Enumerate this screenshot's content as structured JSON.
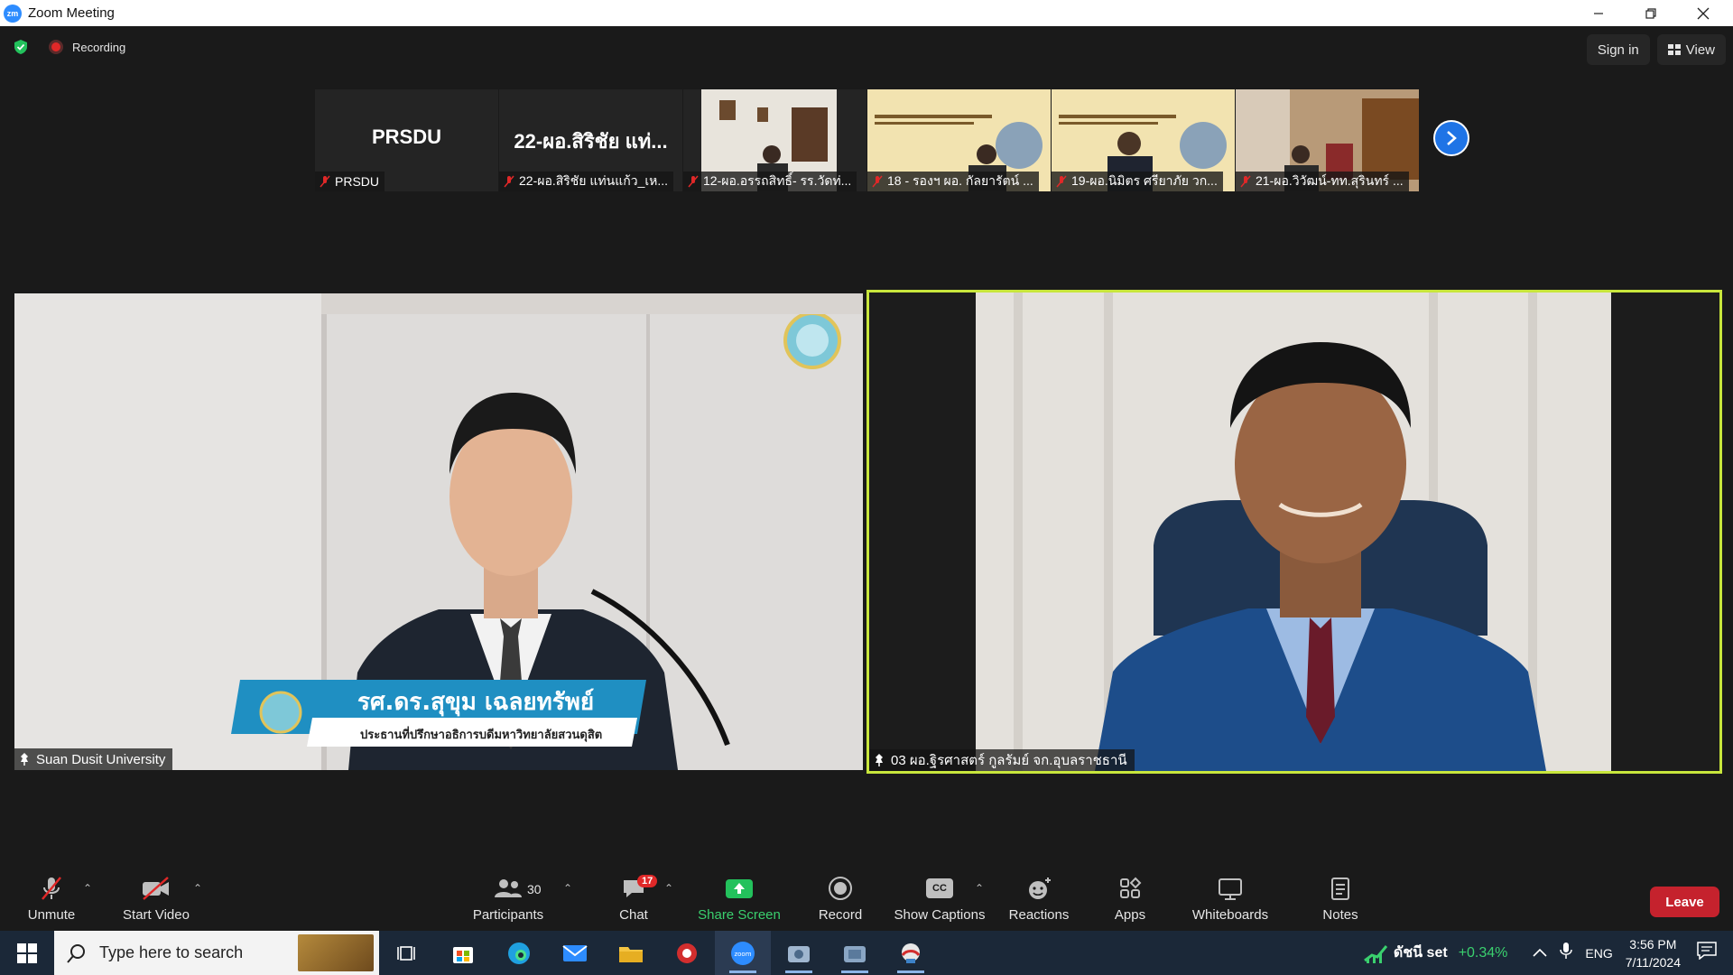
{
  "window": {
    "app_icon_text": "zm",
    "title": "Zoom Meeting"
  },
  "topbar": {
    "recording_label": "Recording",
    "signin_label": "Sign in",
    "view_label": "View"
  },
  "strip": [
    {
      "big_name": "PRSDU",
      "label": "PRSDU",
      "has_video": false
    },
    {
      "big_name": "22-ผอ.สิริชัย แท่...",
      "label": "22-ผอ.สิริชัย แท่นแก้ว_เห...",
      "has_video": false
    },
    {
      "big_name": "",
      "label": "12-ผอ.อรรถสิทธิ์- รร.วัดท่...",
      "has_video": true
    },
    {
      "big_name": "",
      "label": "18 - รองฯ ผอ. กัลยารัตน์ ...",
      "has_video": true
    },
    {
      "big_name": "",
      "label": "19-ผอ.นิมิตร ศรียาภัย วก...",
      "has_video": true
    },
    {
      "big_name": "",
      "label": "21-ผอ.วิวัฒน์-ทท.สุรินทร์ ...",
      "has_video": true
    }
  ],
  "main": {
    "left": {
      "name": "Suan Dusit University",
      "banner_name": "รศ.ดร.สุขุม เฉลยทรัพย์",
      "banner_title": "ประธานที่ปรึกษาอธิการบดีมหาวิทยาลัยสวนดุสิต"
    },
    "right": {
      "name": "03 ผอ.ฐิรศาสตร์ กูลรัมย์ จก.อุบลราชธานี"
    }
  },
  "toolbar": {
    "unmute": "Unmute",
    "start_video": "Start Video",
    "participants": "Participants",
    "participants_count": "30",
    "chat": "Chat",
    "chat_badge": "17",
    "share": "Share Screen",
    "record": "Record",
    "captions": "Show Captions",
    "captions_icon": "CC",
    "reactions": "Reactions",
    "apps": "Apps",
    "whiteboards": "Whiteboards",
    "notes": "Notes",
    "leave": "Leave"
  },
  "taskbar": {
    "search_placeholder": "Type here to search",
    "stock_name": "ดัชนี set",
    "stock_change": "+0.34%",
    "lang": "ENG",
    "time": "3:56 PM",
    "date": "7/11/2024"
  },
  "colors": {
    "zoom_blue": "#2d8cff",
    "active_speaker": "#c8e63c",
    "leave_red": "#c5222d",
    "share_green": "#3ad06e"
  }
}
